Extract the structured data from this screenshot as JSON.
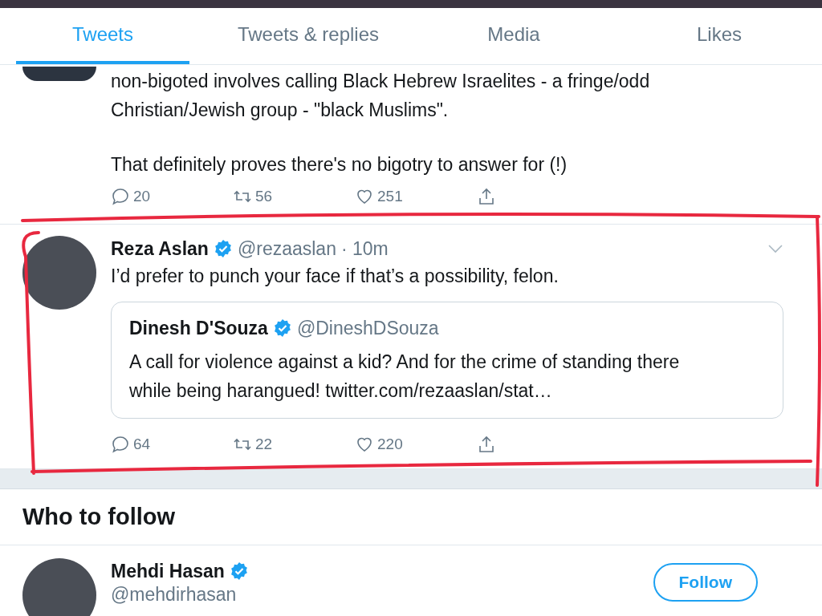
{
  "tabs": [
    {
      "label": "Tweets",
      "selected": true
    },
    {
      "label": "Tweets & replies",
      "selected": false
    },
    {
      "label": "Media",
      "selected": false
    },
    {
      "label": "Likes",
      "selected": false
    }
  ],
  "tweets": [
    {
      "paragraphs": [
        [
          "non-bigoted involves calling Black Hebrew Israelites - a fringe/odd",
          "Christian/Jewish group - \"black Muslims\"."
        ],
        [
          "That definitely proves there's no bigotry to answer for (!)"
        ]
      ],
      "replies": "20",
      "retweets": "56",
      "likes": "251"
    },
    {
      "name": "Reza Aslan",
      "verified": true,
      "handle": "@rezaaslan",
      "time": "· 10m",
      "paragraphs": [
        [
          "I’d prefer to punch your face if that’s a possibility, felon."
        ]
      ],
      "quote": {
        "name": "Dinesh D'Souza",
        "verified": true,
        "handle": "@DineshDSouza",
        "text": "A call for violence against a kid? And for the crime of standing there while being harangued! twitter.com/rezaaslan/stat…"
      },
      "replies": "64",
      "retweets": "22",
      "likes": "220"
    }
  ],
  "who_to_follow": {
    "title": "Who to follow",
    "accounts": [
      {
        "name": "Mehdi Hasan",
        "verified": true,
        "handle": "@mehdirhasan",
        "button": "Follow"
      }
    ]
  }
}
